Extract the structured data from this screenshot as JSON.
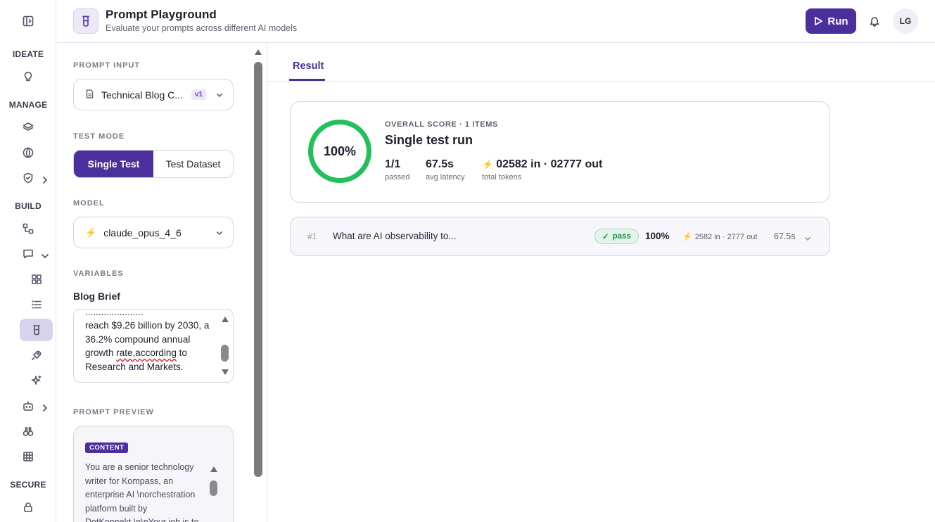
{
  "nav": {
    "sections": {
      "ideate": "IDEATE",
      "manage": "MANAGE",
      "build": "BUILD",
      "secure": "SECURE"
    },
    "icons": [
      "panel-toggle-icon",
      "lightbulb-icon",
      "layers-icon",
      "globe-icon",
      "shield-icon",
      "nodes-icon",
      "chat-icon",
      "grid-icon",
      "list-icon",
      "beaker-icon",
      "rocket-icon",
      "sparkle-icon",
      "bot-icon",
      "binoculars-icon",
      "table-icon",
      "lock-icon"
    ]
  },
  "header": {
    "title": "Prompt Playground",
    "subtitle": "Evaluate your prompts across different AI models",
    "run_label": "Run",
    "avatar_initials": "LG"
  },
  "config": {
    "prompt_input_label": "PROMPT INPUT",
    "prompt_name": "Technical Blog C...",
    "prompt_version": "v1",
    "test_mode_label": "TEST MODE",
    "mode_single": "Single Test",
    "mode_dataset": "Test Dataset",
    "model_label": "MODEL",
    "model_name": "claude_opus_4_6",
    "variables_label": "VARIABLES",
    "variable_name": "Blog Brief",
    "variable_value_line1": "reach $9.26 billion by 2030, a 36.2% compound annual growth",
    "variable_value_spell": "rate,according",
    "variable_value_line2": " to Research and Markets.",
    "prompt_preview_label": "PROMPT PREVIEW",
    "preview_badge": "CONTENT",
    "preview_text": "You are a senior technology writer for Kompass, an enterprise AI \\norchestration platform built by DotKonnekt.\\n\\nYour job is to"
  },
  "results": {
    "tab_label": "Result",
    "overall_label": "OVERALL SCORE · 1 ITEMS",
    "run_title": "Single test run",
    "score_pct": "100%",
    "score_fraction": 1.0,
    "passed_value": "1/1",
    "passed_label": "passed",
    "latency_value": "67.5s",
    "latency_label": "avg latency",
    "tokens_value": "02582 in · 02777 out",
    "tokens_label": "total tokens",
    "items": [
      {
        "num": "#1",
        "question": "What are AI observability to...",
        "status": "pass",
        "score": "100%",
        "tokens": "2582 in · 2777 out",
        "latency": "67.5s"
      }
    ]
  },
  "colors": {
    "accent": "#4b2f9c",
    "ring": "#22c05a",
    "bolt": "#f2b318"
  }
}
